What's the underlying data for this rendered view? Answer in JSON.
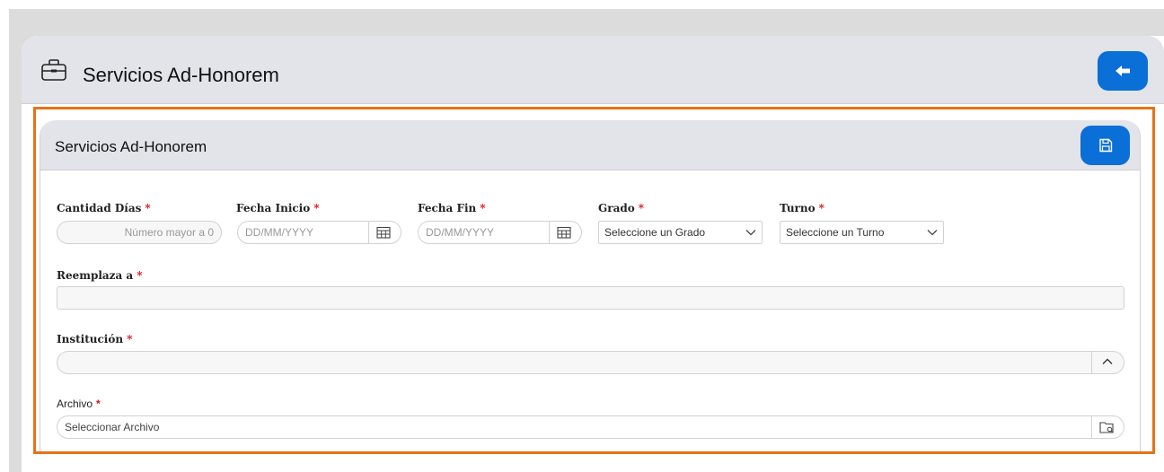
{
  "page": {
    "title": "Servicios Ad-Honorem",
    "icon": "briefcase-icon"
  },
  "header": {
    "back_icon": "arrow-left-icon"
  },
  "form": {
    "title": "Servicios Ad-Honorem",
    "save_icon": "save-icon",
    "fields": {
      "cantidad": {
        "label": "Cantidad Días",
        "required": "*",
        "placeholder": "Número mayor a 0"
      },
      "fecha_inicio": {
        "label": "Fecha Inicio",
        "required": "*",
        "placeholder": "DD/MM/YYYY"
      },
      "fecha_fin": {
        "label": "Fecha Fin",
        "required": "*",
        "placeholder": "DD/MM/YYYY"
      },
      "grado": {
        "label": "Grado",
        "required": "*",
        "value": "Seleccione un Grado"
      },
      "turno": {
        "label": "Turno",
        "required": "*",
        "value": "Seleccione un Turno"
      },
      "reemplaza": {
        "label": "Reemplaza a",
        "required": "*",
        "value": ""
      },
      "institucion": {
        "label": "Institución",
        "required": "*",
        "value": ""
      },
      "archivo": {
        "label": "Archivo",
        "required": "*",
        "placeholder": "Seleccionar Archivo"
      }
    }
  },
  "colors": {
    "accent": "#0a6fd6",
    "highlight": "#e67317",
    "required": "#d11"
  }
}
